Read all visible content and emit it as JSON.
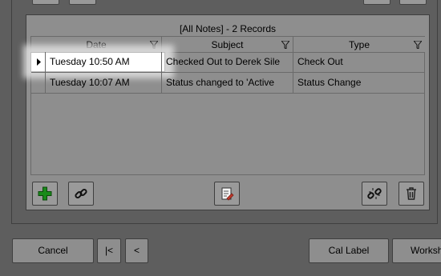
{
  "notes": {
    "title": "[All Notes] - 2 Records",
    "columns": [
      "Date",
      "Subject",
      "Type"
    ],
    "rows": [
      {
        "date": "Tuesday 10:50 AM",
        "subject": "Checked Out to Derek Sile",
        "type": "Check Out"
      },
      {
        "date": "Tuesday 10:07 AM",
        "subject": "Status changed to 'Active",
        "type": "Status Change"
      }
    ]
  },
  "toolbar": {
    "icons": [
      "add-icon",
      "link-icon",
      "edit-note-icon",
      "unlink-icon",
      "trash-icon"
    ],
    "add_color": "#1a8a1a"
  },
  "bottom": {
    "cancel_label": "Cancel",
    "first_label": "|<",
    "prev_label": "<",
    "cal_label": "Cal Label",
    "workshop_label": "Worksh"
  }
}
